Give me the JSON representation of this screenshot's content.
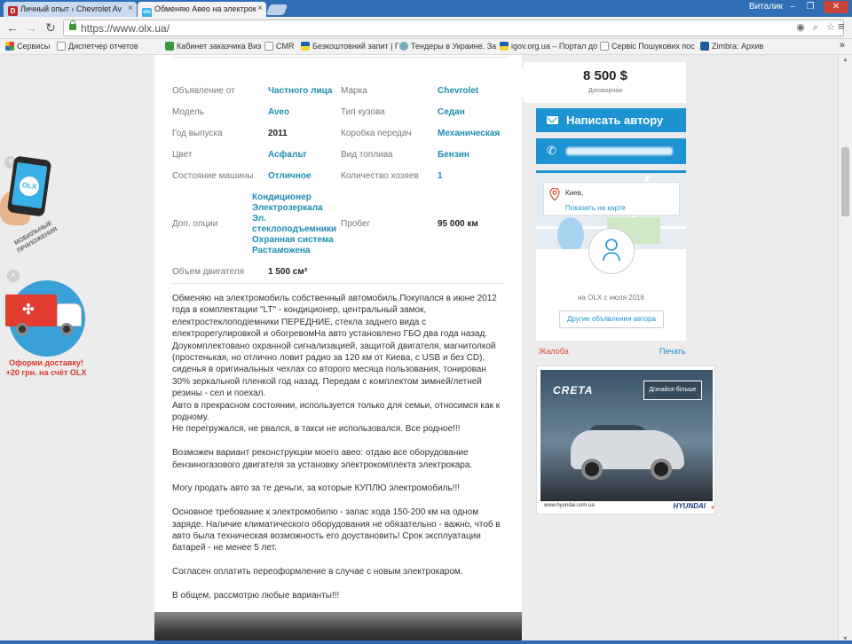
{
  "browser": {
    "tabs": [
      {
        "label": "Личный опыт › Chevrolet Av",
        "favicon": "D",
        "favicon_color": "#c0282d"
      },
      {
        "label": "Обменяю Авео на электрок",
        "favicon": "olx",
        "favicon_color": "#3ab0e8"
      }
    ],
    "user": "Виталик",
    "url": "https://www.olx.ua/",
    "bookmarks": [
      {
        "label": "Сервисы",
        "icon": "apps-icon"
      },
      {
        "label": "Диспетчер отчетов",
        "icon": "page-icon"
      },
      {
        "label": "Кабинет заказчика Виз",
        "icon": "page-icon"
      },
      {
        "label": "CMR",
        "icon": "page-icon"
      },
      {
        "label": "Безкоштовний запит | Г",
        "icon": "ua-flag-icon"
      },
      {
        "label": "Тендеры в Украине. За",
        "icon": "globe-icon"
      },
      {
        "label": "igov.org.ua – Портал до",
        "icon": "ua-flag-icon"
      },
      {
        "label": "Сервіс Пошукових пос",
        "icon": "page-icon"
      },
      {
        "label": "Zimbra: Архив",
        "icon": "zimbra-icon"
      }
    ]
  },
  "promos": {
    "app_text": "МОБИЛЬНЫЕ ПРИЛОЖЕНИЯ",
    "app_logo": "OLX",
    "delivery_text_line1": "Оформи доставку!",
    "delivery_text_line2": "+20 грн. на счёт OLX"
  },
  "specs": [
    {
      "label": "Объявление от",
      "value": "Частного лица",
      "link": true
    },
    {
      "label": "Марка",
      "value": "Chevrolet",
      "link": true
    },
    {
      "label": "Модель",
      "value": "Aveo",
      "link": true
    },
    {
      "label": "Тип кузова",
      "value": "Седан",
      "link": true
    },
    {
      "label": "Год выпуска",
      "value": "2011",
      "link": false
    },
    {
      "label": "Коробка передач",
      "value": "Механическая",
      "link": true
    },
    {
      "label": "Цвет",
      "value": "Асфальт",
      "link": true
    },
    {
      "label": "Вид топлива",
      "value": "Бензин",
      "link": true
    },
    {
      "label": "Состояние машины",
      "value": "Отличное",
      "link": true
    },
    {
      "label": "Количество хозяев",
      "value": "1",
      "link": true
    },
    {
      "label": "Доп. опции",
      "value": [
        "Кондиционер",
        "Электрозеркала",
        "Эл.",
        "стеклоподъемники",
        "Охранная система",
        "Растаможена"
      ],
      "link": true
    },
    {
      "label": "Пробег",
      "value": "95 000 км",
      "link": false
    },
    {
      "label": "Объем двигателя",
      "value": "1 500 см³",
      "link": false
    }
  ],
  "description": [
    "Обменяю на электромобиль собственный автомобиль.Покупался в июне 2012 года в комплектации \"LT\" - кондиционер, центральный замок, електростеклоподіемники ПЕРЕДНИЕ, стекла заднего вида с електрорегулировкой и обогревомНа авто установлено ГБО два года назад. Доукомплектовано охранной сигнализацией, защитой двигателя, магнитолкой (простенькая, но отлично ловит радио за 120 км от Киева, с USB и без CD), сиденья в оригинальных чехлах со второго месяца пользования, тонирован 30% зеркальной пленкой год назад. Передам с комплектом зимней/летней резины - сел и поехал.\nАвто в прекрасном состоянии, используется только для семьи, относимся как к родному.\nНе перегружался, не рвался, в такси не использовался. Все родное!!!",
    "Возможен вариант реконструкции моего авео: отдаю все оборудование бензиногазового двигателя за установку электрокомплекта электрокара.",
    "Могу продать авто за те деньги, за которые КУПЛЮ электромобиль!!!",
    "Основное требование к электромобилю - запас хода 150-200 км на одном заряде. Наличие климатического оборудования не обязательно - важно, чтоб в авто была техническая возможность его доустановить! Срок эксплуатации батарей - не менее 5 лет.",
    "Согласен оплатить переоформление в случае с новым электрокаром.",
    "В общем, рассмотрю любые варианты!!!"
  ],
  "sidebar": {
    "price": "8 500 $",
    "price_note": "Договорная",
    "write_button": "Написать автору",
    "city": "Киев,",
    "show_on_map": "Показать на карте",
    "member_since": "на OLX с июля 2016",
    "other_ads": "Другие объявления автора",
    "complain": "Жалоба",
    "print": "Печать"
  },
  "ad": {
    "brand": "CRETA",
    "cta": "Дізнайся більше",
    "site": "www.hyundai.com.ua",
    "maker": "HYUNDAI"
  }
}
